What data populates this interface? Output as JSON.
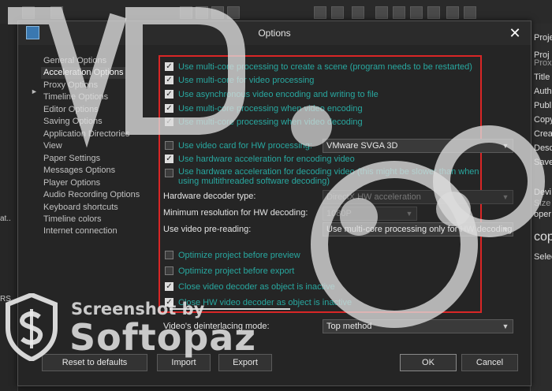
{
  "dialog": {
    "title": "Options",
    "close_label": "✕"
  },
  "nav": {
    "items": [
      {
        "label": "General Options"
      },
      {
        "label": "Acceleration Options",
        "active": true
      },
      {
        "label": "Proxy Options"
      },
      {
        "label": "Timeline Options"
      },
      {
        "label": "Editor Options"
      },
      {
        "label": "Saving Options"
      },
      {
        "label": "Application Directories"
      },
      {
        "label": "View"
      },
      {
        "label": "Paper Settings"
      },
      {
        "label": "Messages Options"
      },
      {
        "label": "Player Options"
      },
      {
        "label": "Audio Recording Options"
      },
      {
        "label": "Keyboard shortcuts"
      },
      {
        "label": "Timeline colors"
      },
      {
        "label": "Internet connection"
      }
    ]
  },
  "options": {
    "multicore_scene": {
      "label": "Use multi-core processing to create a scene (program needs to be restarted)",
      "checked": true
    },
    "multicore_video": {
      "label": "Use multi-core for video processing",
      "checked": true
    },
    "async_encoding": {
      "label": "Use asynchronous video encoding and writing to file",
      "checked": true
    },
    "multicore_encoding": {
      "label": "Use multi-core processing when video encoding",
      "checked": true
    },
    "multicore_decoding": {
      "label": "Use multi-core processing when video decoding",
      "checked": true
    },
    "hw_video_card": {
      "label": "Use video card for HW processing:",
      "checked": false
    },
    "hw_encoding": {
      "label": "Use hardware acceleration for encoding video",
      "checked": true
    },
    "hw_decoding": {
      "label": "Use hardware acceleration for decoding video (this might be slower than when using multithreaded software decoding)",
      "checked": false
    },
    "optimize_preview": {
      "label": "Optimize project before preview",
      "checked": false
    },
    "optimize_export": {
      "label": "Optimize project before export",
      "checked": false
    },
    "close_decoder": {
      "label": "Close video decoder as object is inactive",
      "checked": true
    },
    "close_hw_decoder": {
      "label": "Close HW video decoder as object is inactive",
      "checked": true
    }
  },
  "fields": {
    "video_card": {
      "value": "VMware SVGA 3D"
    },
    "hw_decoder_type": {
      "label": "Hardware decoder type:",
      "value": "DirectX HW acceleration"
    },
    "min_resolution": {
      "label": "Minimum resolution for HW decoding:",
      "value": "1080P"
    },
    "pre_reading": {
      "label": "Use video pre-reading:",
      "value": "Use multi-core processing only for HW decoding"
    },
    "deinterlacing": {
      "label": "Video's deinterlacing mode:",
      "value": "Top method"
    }
  },
  "buttons": {
    "reset": "Reset to defaults",
    "import": "Import",
    "export": "Export",
    "ok": "OK",
    "cancel": "Cancel"
  },
  "background": {
    "right_panel": [
      "Proje",
      "Proj",
      "Prox",
      "Title",
      "Auth",
      "Publ",
      "Copy",
      "Crea",
      "Desc",
      "Save",
      "Devi",
      "Size",
      "oper",
      "cop",
      "Selecte"
    ],
    "left_panel": [
      "at..",
      "RS"
    ]
  },
  "watermark": {
    "line1": "Screenshot by",
    "line2": "Softopaz"
  },
  "colors": {
    "accent_teal": "#28a8a0",
    "highlight_red": "#d92626"
  }
}
